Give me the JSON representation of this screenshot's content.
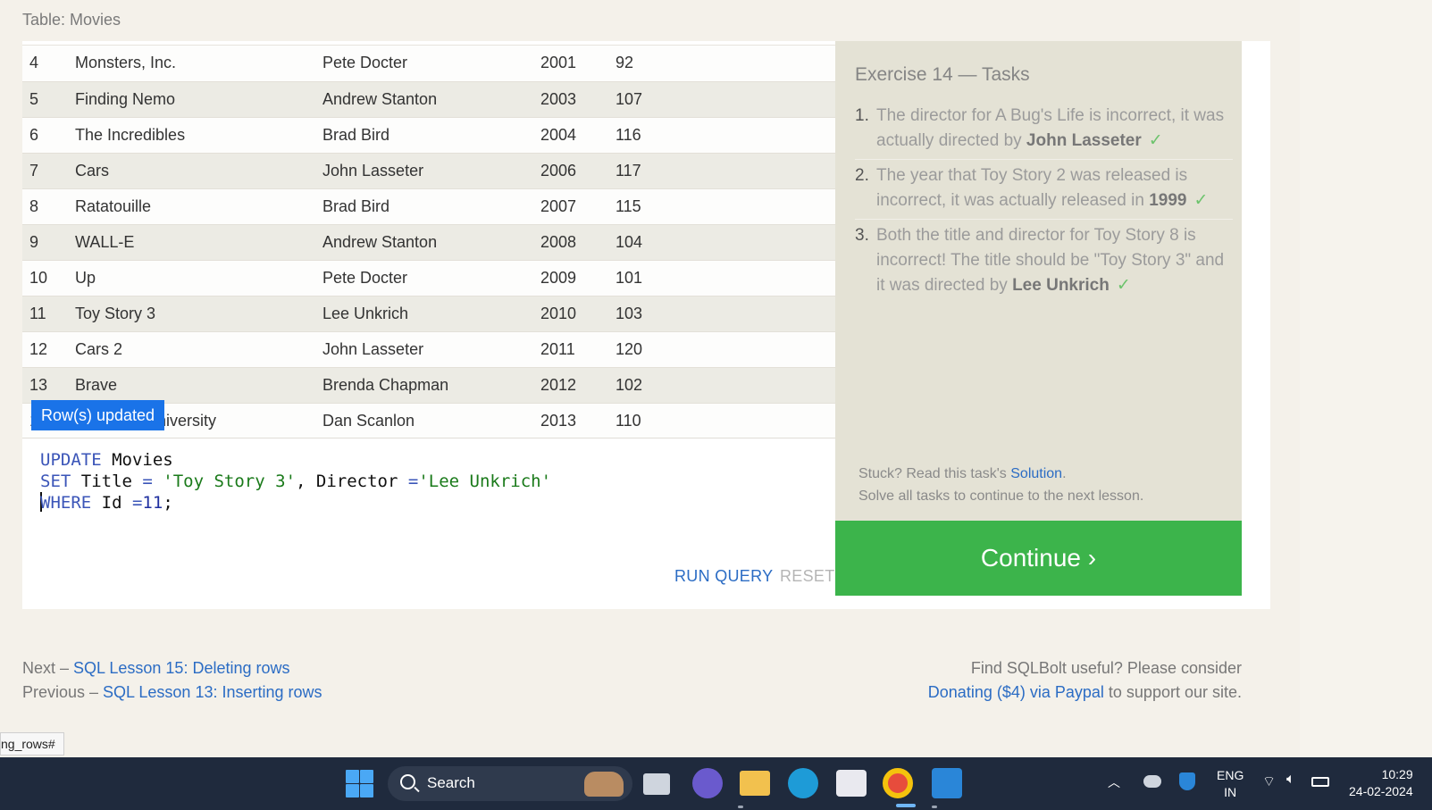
{
  "page": {
    "table_caption": "Table: Movies"
  },
  "table": {
    "rows": [
      {
        "id": "4",
        "title": "Monsters, Inc.",
        "director": "Pete Docter",
        "year": "2001",
        "length": "92"
      },
      {
        "id": "5",
        "title": "Finding Nemo",
        "director": "Andrew Stanton",
        "year": "2003",
        "length": "107"
      },
      {
        "id": "6",
        "title": "The Incredibles",
        "director": "Brad Bird",
        "year": "2004",
        "length": "116"
      },
      {
        "id": "7",
        "title": "Cars",
        "director": "John Lasseter",
        "year": "2006",
        "length": "117"
      },
      {
        "id": "8",
        "title": "Ratatouille",
        "director": "Brad Bird",
        "year": "2007",
        "length": "115"
      },
      {
        "id": "9",
        "title": "WALL-E",
        "director": "Andrew Stanton",
        "year": "2008",
        "length": "104"
      },
      {
        "id": "10",
        "title": "Up",
        "director": "Pete Docter",
        "year": "2009",
        "length": "101"
      },
      {
        "id": "11",
        "title": "Toy Story 3",
        "director": "Lee Unkrich",
        "year": "2010",
        "length": "103"
      },
      {
        "id": "12",
        "title": "Cars 2",
        "director": "John Lasseter",
        "year": "2011",
        "length": "120"
      },
      {
        "id": "13",
        "title": "Brave",
        "director": "Brenda Chapman",
        "year": "2012",
        "length": "102"
      },
      {
        "id": "14",
        "title": "Monsters University",
        "director": "Dan Scanlon",
        "year": "2013",
        "length": "110"
      }
    ],
    "toast": "Row(s) updated"
  },
  "editor": {
    "line1": {
      "kw": "UPDATE",
      "rest": " Movies"
    },
    "line2": {
      "kw": "SET",
      "a": " Title ",
      "eq1": "=",
      "s1": " 'Toy Story 3'",
      "b": ", Director ",
      "eq2": "=",
      "s2": "'Lee Unkrich'"
    },
    "line3": {
      "kw": "WHERE",
      "a": " Id ",
      "eq": "=",
      "num": "11",
      "end": ";"
    },
    "run_label": "RUN QUERY",
    "reset_label": "RESET"
  },
  "tasks": {
    "title": "Exercise 14 — Tasks",
    "items": [
      {
        "num": "1.",
        "text": "The director for A Bug's Life is incorrect, it was actually directed by ",
        "bold": "John Lasseter",
        "check": "✓"
      },
      {
        "num": "2.",
        "text": "The year that Toy Story 2 was released is incorrect, it was actually released in ",
        "bold": "1999",
        "check": "✓"
      },
      {
        "num": "3.",
        "text": "Both the title and director for Toy Story 8 is incorrect! The title should be \"Toy Story 3\" and it was directed by ",
        "bold": "Lee Unkrich",
        "check": "✓"
      }
    ],
    "stuck_prefix": "Stuck? Read this task's ",
    "solution_link": "Solution",
    "stuck_suffix": ".",
    "stuck_line2": "Solve all tasks to continue to the next lesson.",
    "continue_label": "Continue ›"
  },
  "nav": {
    "next_prefix": "Next – ",
    "next_link": "SQL Lesson 15: Deleting rows",
    "prev_prefix": "Previous – ",
    "prev_link": "SQL Lesson 13: Inserting rows",
    "donate_line1": "Find SQLBolt useful? Please consider",
    "donate_link": "Donating ($4) via Paypal",
    "donate_suffix": " to support our site."
  },
  "status_url": "ng_rows#",
  "taskbar": {
    "search_label": "Search",
    "lang_1": "ENG",
    "lang_2": "IN",
    "time": "10:29",
    "date": "24-02-2024"
  },
  "colors": {
    "accent_link": "#2b6cc4",
    "continue_green": "#3cb44b",
    "toast_blue": "#1a73e8",
    "taskbar_bg": "#1f2a3d"
  }
}
